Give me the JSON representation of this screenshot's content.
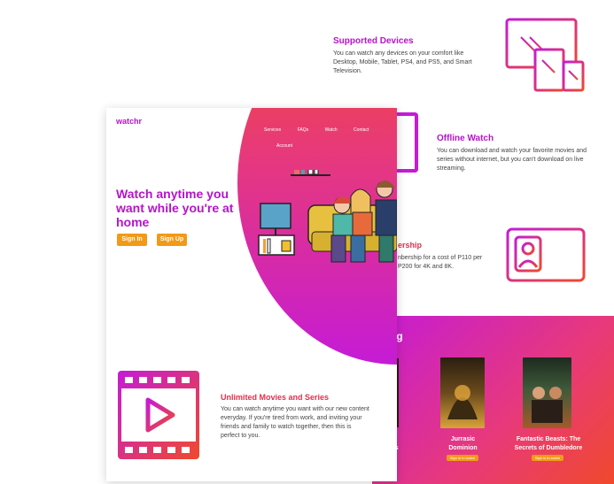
{
  "brand": "watchr",
  "nav": [
    "Services",
    "FAQs",
    "Watch",
    "Contact",
    "Account"
  ],
  "hero": {
    "headline": "Watch anytime you want while you're at home",
    "signin": "Sign In",
    "signup": "Sign Up"
  },
  "features": {
    "devices": {
      "title": "Supported Devices",
      "desc": "You can watch any devices on your comfort like Desktop, Mobile, Tablet, PS4, and PS5, and Smart Television."
    },
    "offline": {
      "title": "Offline Watch",
      "desc": "You can download and watch your favorite movies and series without internet, but you can't download on live streaming."
    },
    "membership": {
      "title": "ership",
      "desc": "nbership for a cost of P110 per P200 for 4K and 8K."
    },
    "unlimited": {
      "title": "Unlimited Movies and Series",
      "desc": "You can watch anytime you want with our new content everyday. If you're tired from work, and inviting your friends and family to watch together, then this is perfect to you."
    }
  },
  "movies_section": {
    "title": "ng",
    "items": [
      {
        "title": "Jurrasic Dominion",
        "btn": "Sign in to watch"
      },
      {
        "title": "Fantastic Beasts: The Secrets of Dumbledore",
        "btn": "Sign in to watch"
      }
    ],
    "partial_title": "he ess"
  },
  "colors": {
    "accent": "#b514c9",
    "orange": "#f29a16",
    "grad_start": "#c51bd6",
    "grad_end": "#f0492c"
  }
}
